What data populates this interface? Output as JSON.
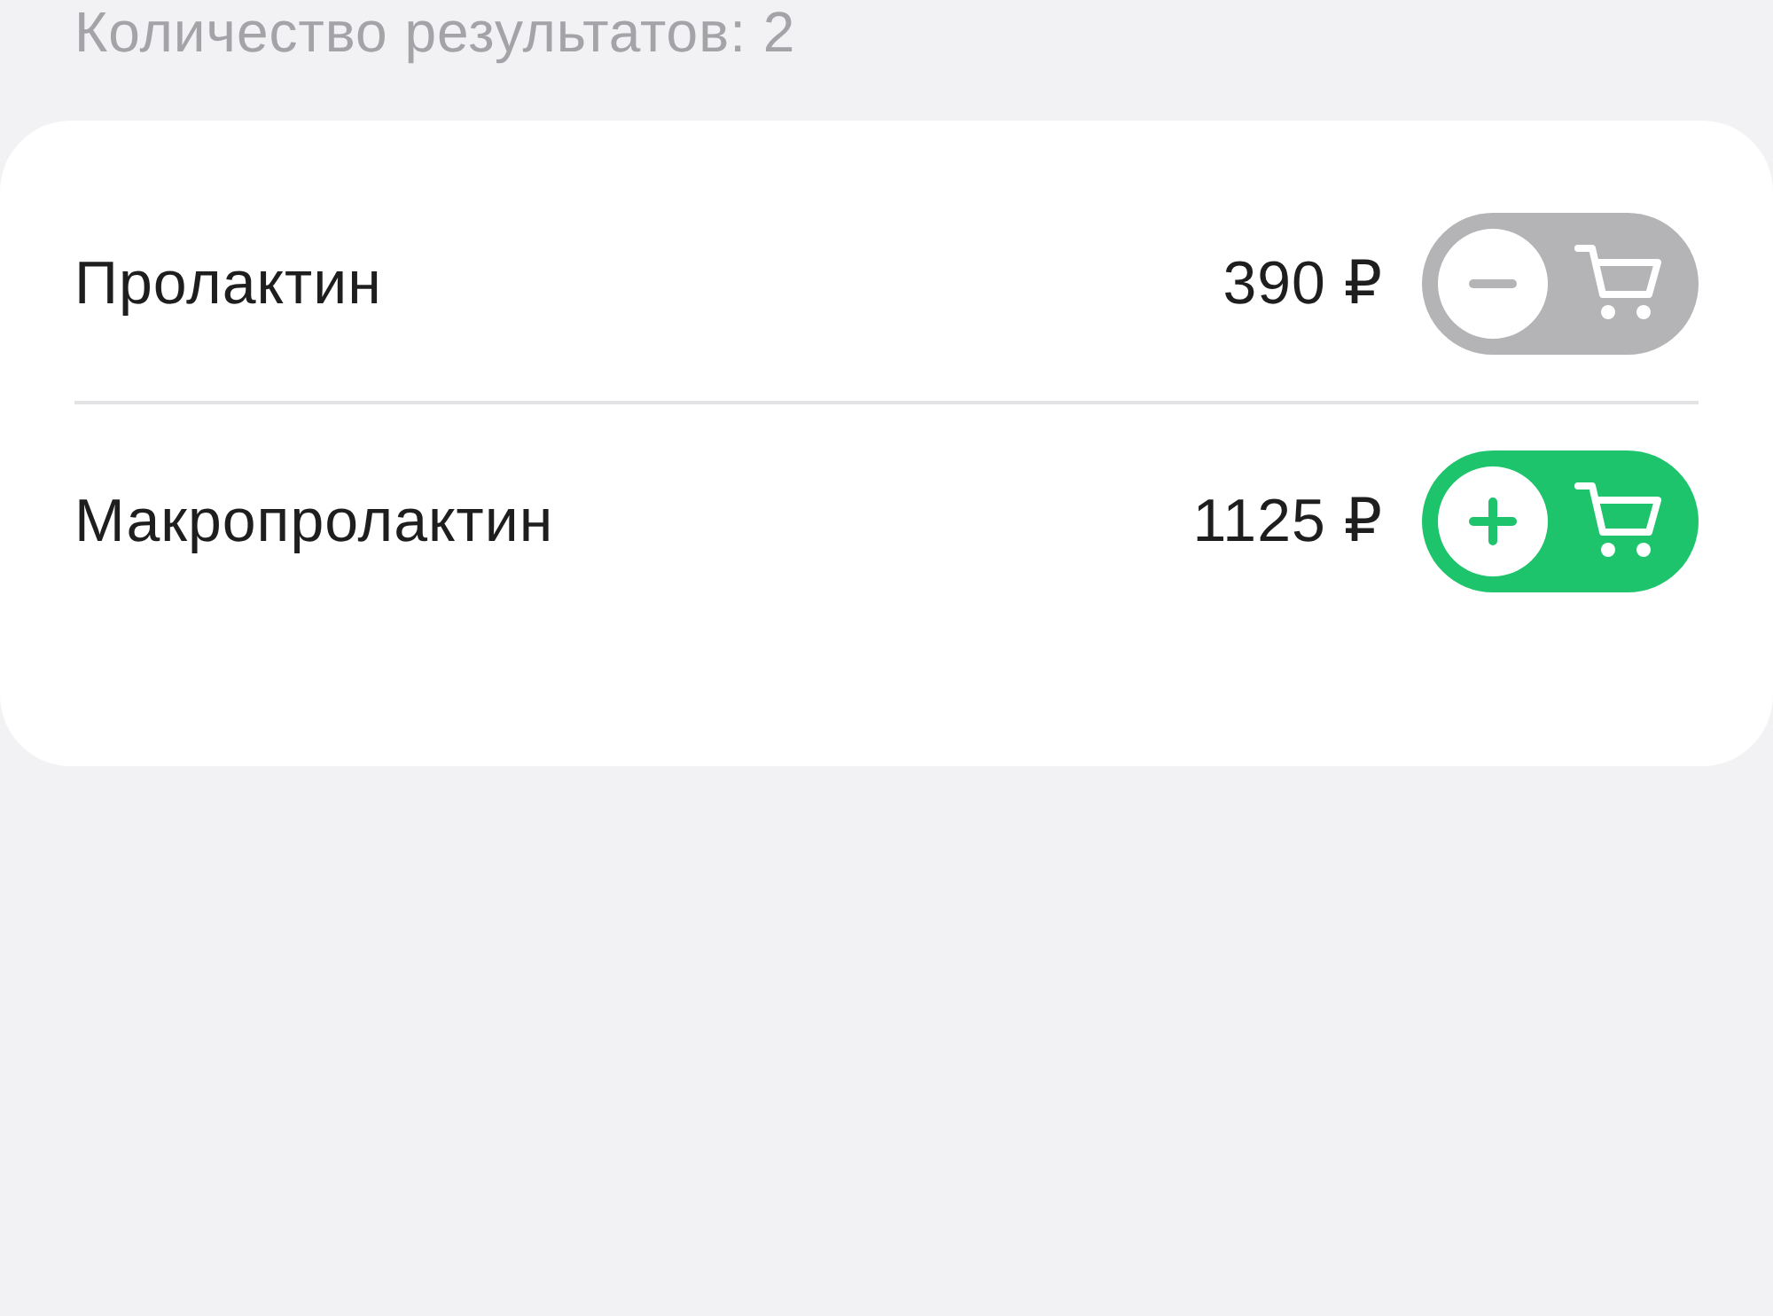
{
  "results_count": "Количество результатов: 2",
  "items": [
    {
      "name": "Пролактин",
      "price": "390 ₽",
      "in_cart": true
    },
    {
      "name": "Макропролактин",
      "price": "1125 ₽",
      "in_cart": false
    }
  ]
}
